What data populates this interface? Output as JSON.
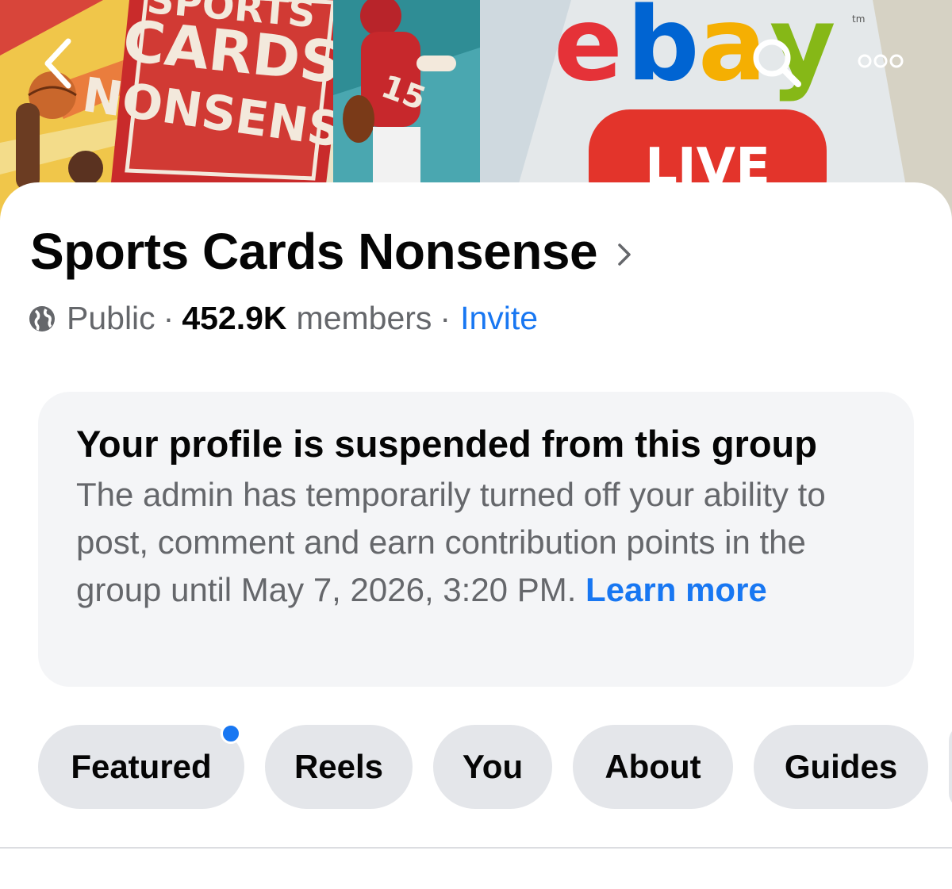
{
  "cover": {
    "art_text_top": "SPORTS",
    "art_text_cards": "CARDS",
    "art_text_nonsense": "NONSENSE",
    "ebay_e": "e",
    "ebay_b": "b",
    "ebay_a": "a",
    "ebay_y": "y",
    "ebay_tm": "tm",
    "live_text": "LIVE",
    "jersey_number": "15"
  },
  "header": {
    "back_icon": "chevron-left-icon",
    "search_icon": "search-icon",
    "more_icon": "more-icon"
  },
  "group": {
    "name": "Sports Cards Nonsense",
    "privacy": "Public",
    "separator": "·",
    "members_count": "452.9K",
    "members_label": "members",
    "invite_label": "Invite"
  },
  "notice": {
    "title": "Your profile is suspended from this group",
    "body": "The admin has temporarily turned off your ability to post, comment and earn contribution points in the group until May 7, 2026, 3:20 PM.",
    "learn_more": "Learn more"
  },
  "tabs": [
    {
      "label": "Featured",
      "has_badge": true
    },
    {
      "label": "Reels"
    },
    {
      "label": "You"
    },
    {
      "label": "About"
    },
    {
      "label": "Guides"
    }
  ],
  "colors": {
    "accent": "#1877f2",
    "secondary_text": "#65676b",
    "notice_bg": "#f4f5f7",
    "tab_bg": "#e4e6ea"
  }
}
